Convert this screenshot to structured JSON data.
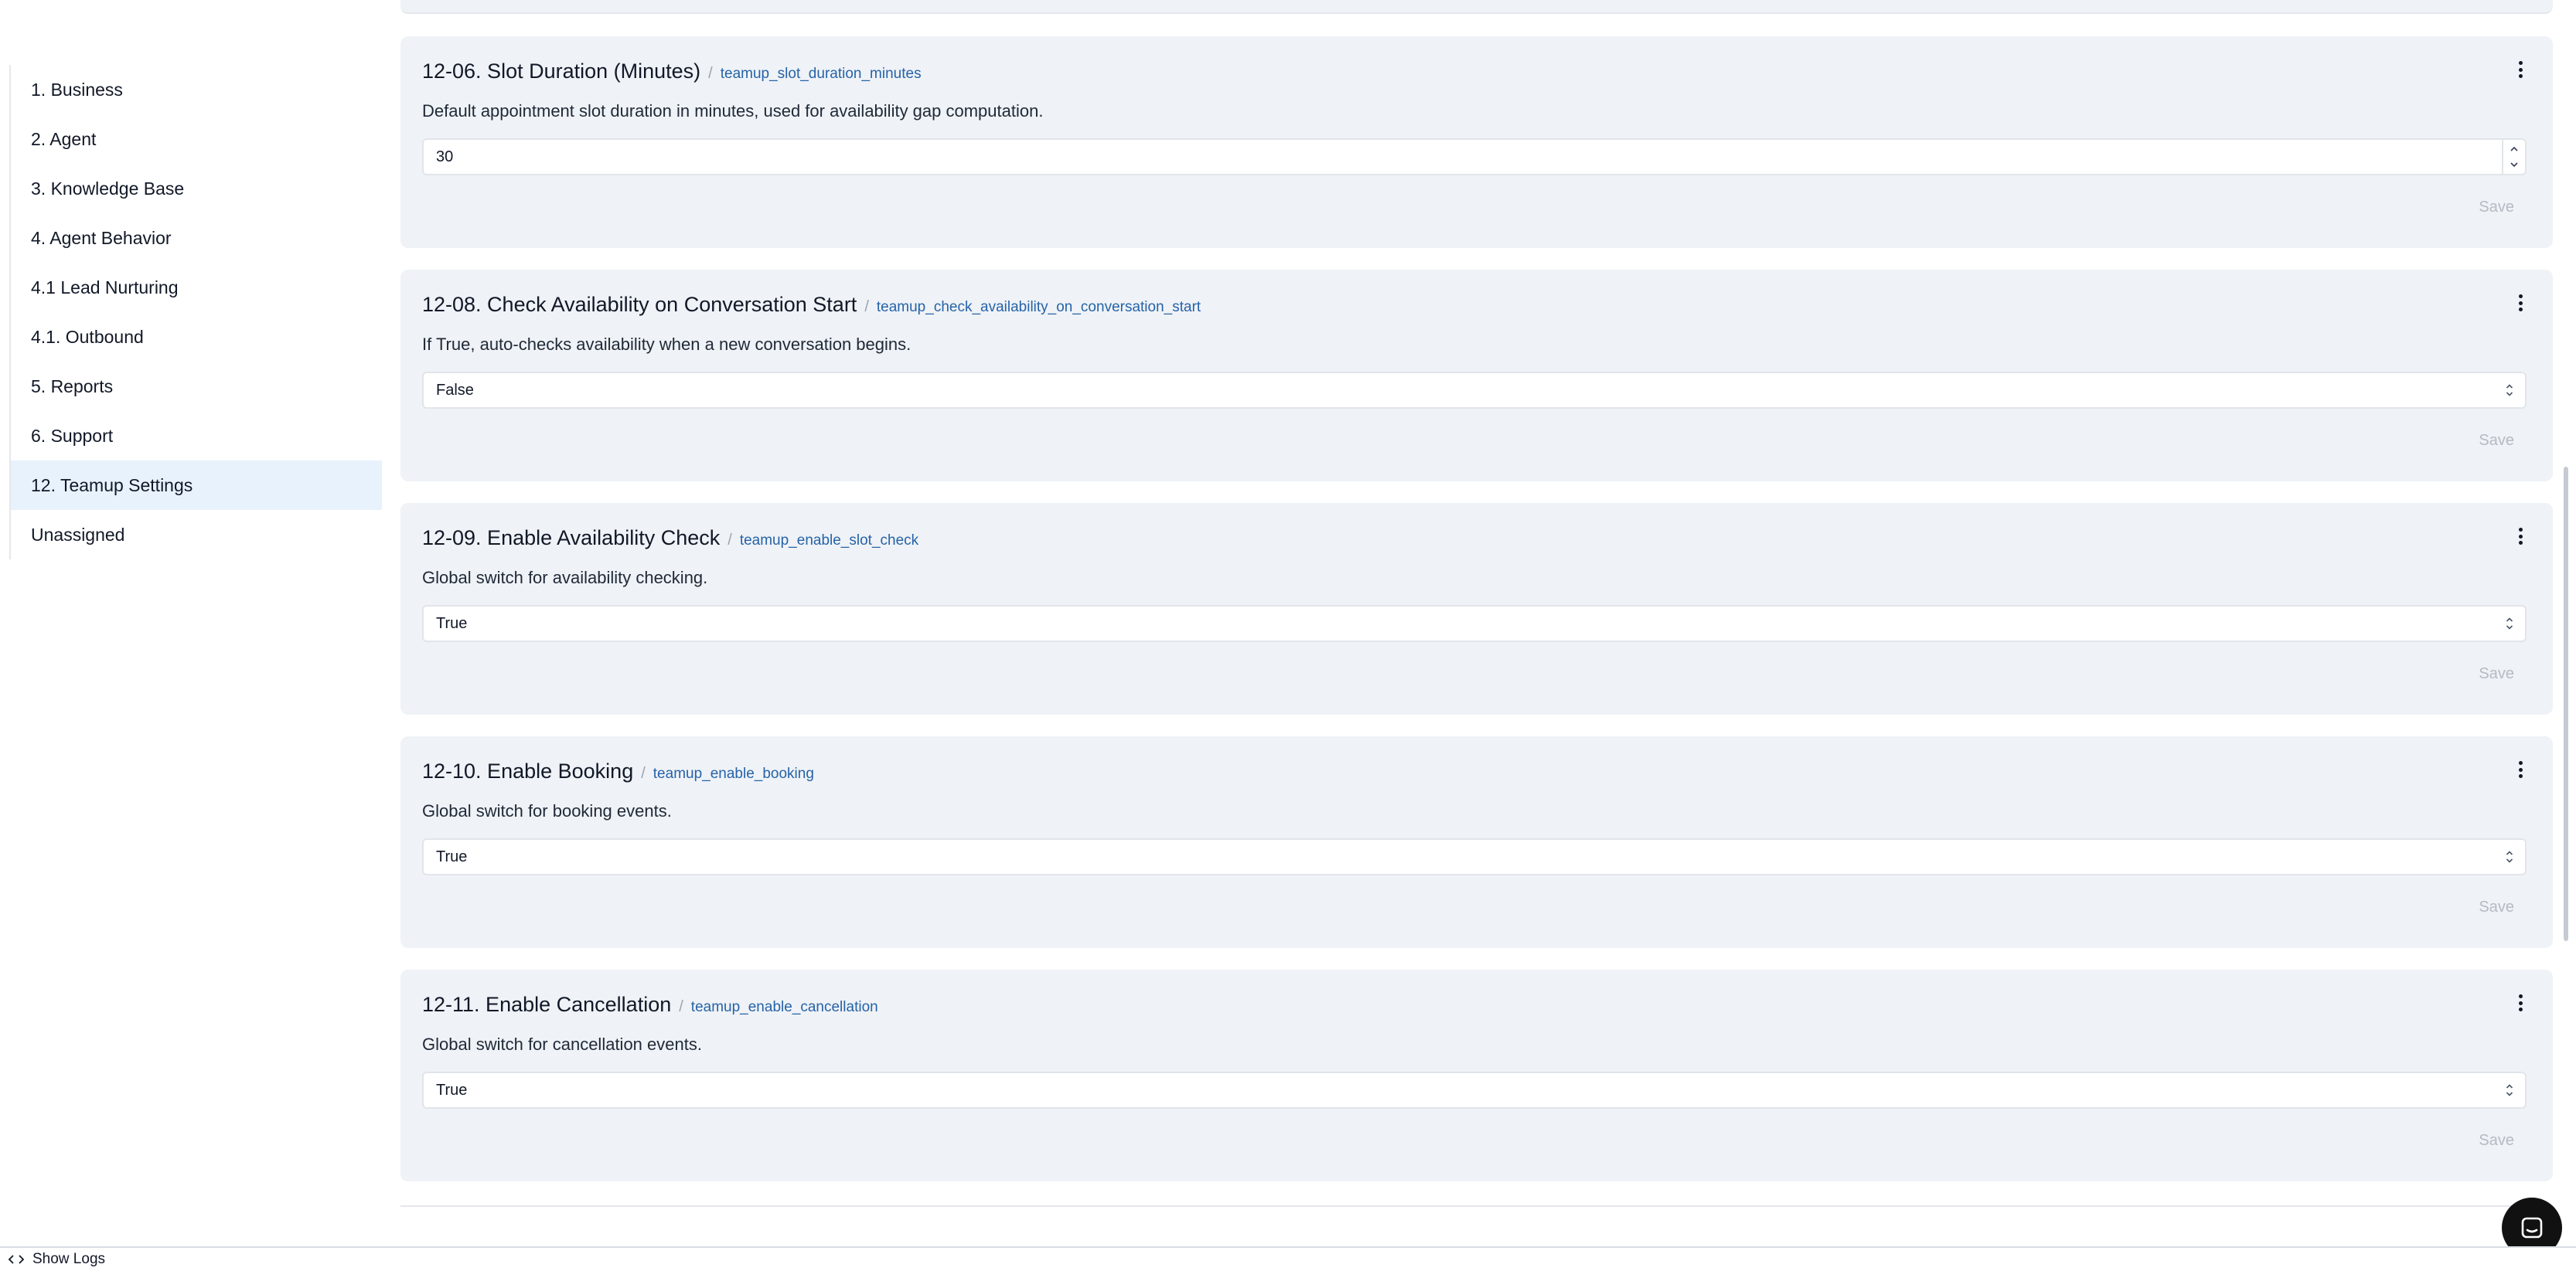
{
  "sidebar": {
    "items": [
      {
        "label": "1. Business"
      },
      {
        "label": "2. Agent"
      },
      {
        "label": "3. Knowledge Base"
      },
      {
        "label": "4. Agent Behavior"
      },
      {
        "label": "4.1 Lead Nurturing"
      },
      {
        "label": "4.1. Outbound"
      },
      {
        "label": "5. Reports"
      },
      {
        "label": "6. Support"
      },
      {
        "label": "12. Teamup Settings",
        "active": true
      },
      {
        "label": "Unassigned"
      }
    ]
  },
  "settings": [
    {
      "title": "12-06. Slot Duration (Minutes)",
      "separator": "/",
      "key": "teamup_slot_duration_minutes",
      "description": "Default appointment slot duration in minutes, used for availability gap computation.",
      "value": "30",
      "control": "number",
      "save_label": "Save"
    },
    {
      "title": "12-08. Check Availability on Conversation Start",
      "separator": "/",
      "key": "teamup_check_availability_on_conversation_start",
      "description": "If True, auto-checks availability when a new conversation begins.",
      "value": "False",
      "control": "select",
      "save_label": "Save"
    },
    {
      "title": "12-09. Enable Availability Check",
      "separator": "/",
      "key": "teamup_enable_slot_check",
      "description": "Global switch for availability checking.",
      "value": "True",
      "control": "select",
      "save_label": "Save"
    },
    {
      "title": "12-10. Enable Booking",
      "separator": "/",
      "key": "teamup_enable_booking",
      "description": "Global switch for booking events.",
      "value": "True",
      "control": "select",
      "save_label": "Save"
    },
    {
      "title": "12-11. Enable Cancellation",
      "separator": "/",
      "key": "teamup_enable_cancellation",
      "description": "Global switch for cancellation events.",
      "value": "True",
      "control": "select",
      "save_label": "Save"
    }
  ],
  "footer": {
    "show_logs_label": "Show Logs"
  },
  "icons": {
    "kebab": "more-vertical-icon",
    "select": "chevron-up-down-icon",
    "logs": "code-icon",
    "chat": "chat-icon"
  },
  "colors": {
    "card_bg": "#eff2f6",
    "active_item_bg": "#e8f2fd",
    "key_link": "#2563a8",
    "save_disabled": "#b5bbc4",
    "chat_bubble": "#111111"
  }
}
